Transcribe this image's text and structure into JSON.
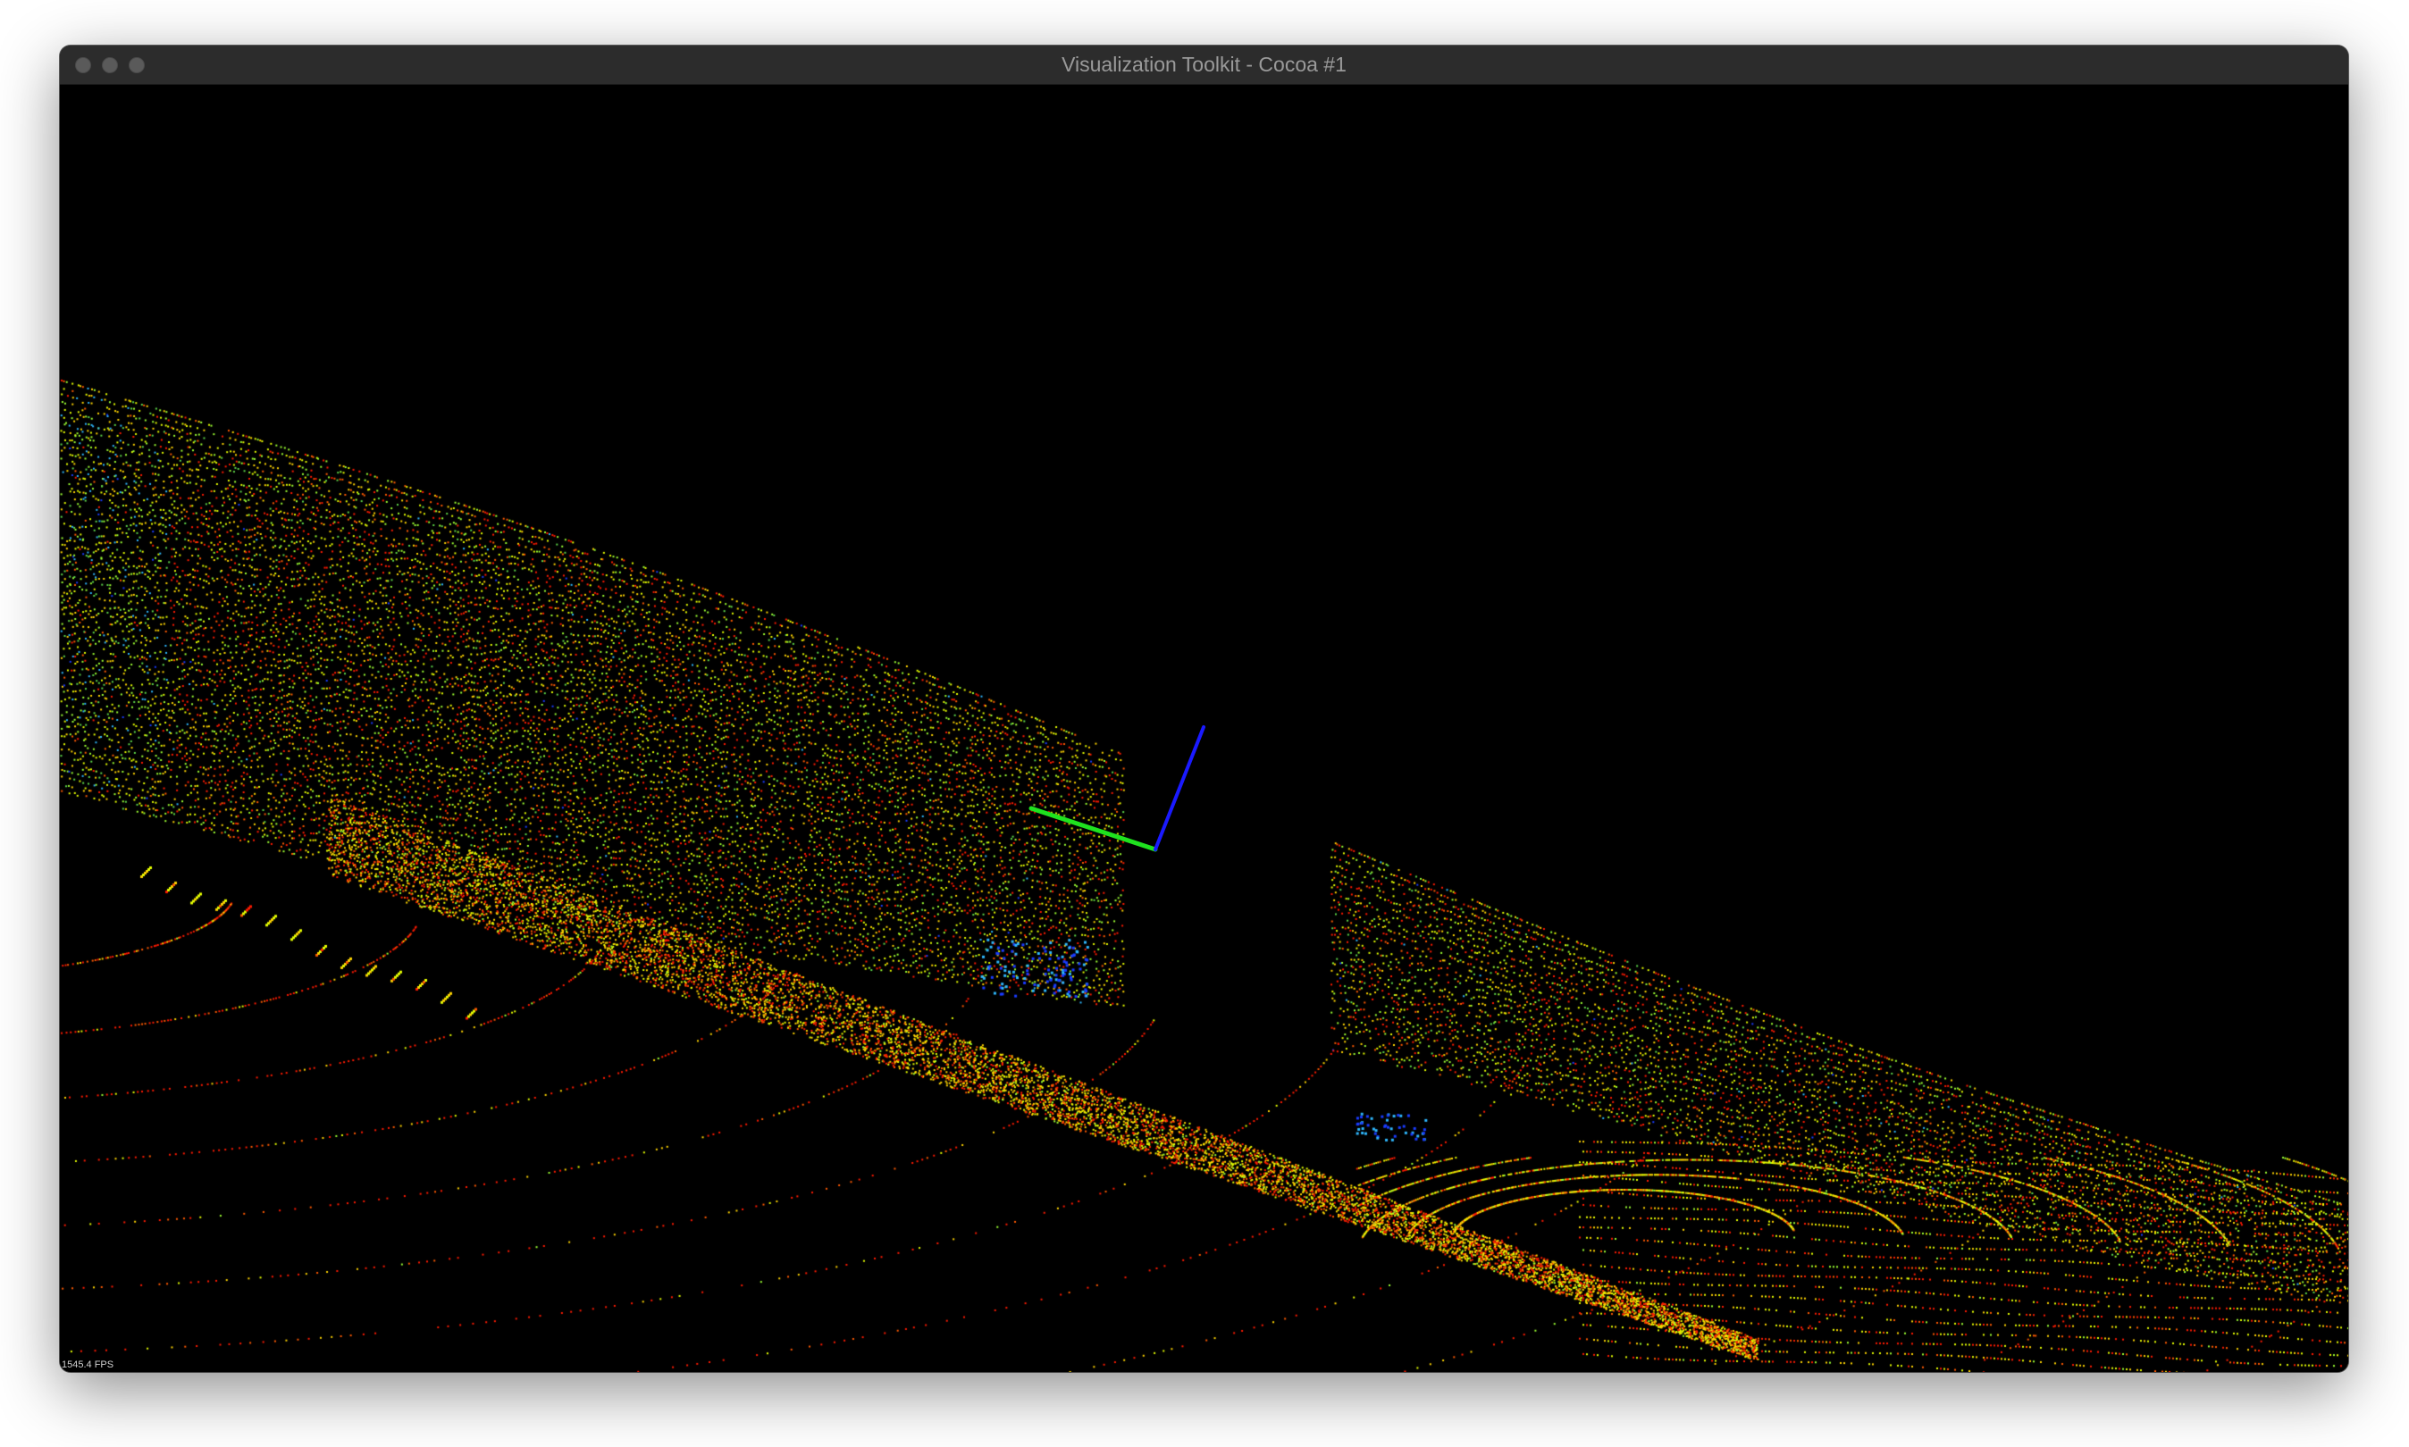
{
  "window": {
    "title": "Visualization Toolkit - Cocoa #1"
  },
  "viewport": {
    "fps_text": "1545.4 FPS",
    "background_color": "#000000",
    "point_colors": [
      "#ff1a00",
      "#ff5a00",
      "#ffd400",
      "#e6ff00",
      "#9cff33",
      "#5fd84a",
      "#2fb8ff",
      "#1a3cff"
    ],
    "axes": {
      "x_axis_color": "#1fe21f",
      "z_axis_color": "#1a1aff"
    }
  }
}
